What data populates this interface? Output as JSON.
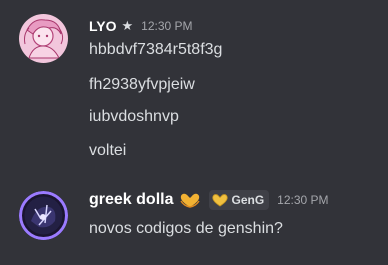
{
  "messages": [
    {
      "author": "LYO",
      "role_icon": "star-icon",
      "role_symbol": "★",
      "timestamp": "12:30 PM",
      "lines": [
        "hbbdvf7384r5t8f3g",
        "fh2938yfvpjeiw",
        "iubvdoshnvp",
        "voltei"
      ]
    },
    {
      "author": "greek dolla",
      "emoji": "heart-hands-icon",
      "tag": {
        "icon": "gold-heart-icon",
        "label": "GenG"
      },
      "timestamp": "12:30 PM",
      "lines": [
        "novos codigos de genshin?"
      ]
    }
  ],
  "colors": {
    "background": "#323339",
    "text": "#dbdee1",
    "username": "#ffffff",
    "timestamp": "#a4a6ab",
    "tag_background": "#3f4047",
    "heart_gold": "#f0c040"
  }
}
